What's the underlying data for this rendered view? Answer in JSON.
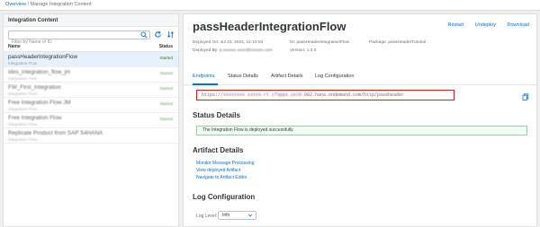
{
  "breadcrumb": {
    "link": "Overview",
    "separator": " / ",
    "current": "Manage Integration Content"
  },
  "left": {
    "title": "Integration Content",
    "search_placeholder": "Filter by Name or ID",
    "columns": {
      "name": "Name",
      "status": "Status"
    },
    "items": [
      {
        "name": "passHeaderIntegrationFlow",
        "sub": "Integration Flow",
        "status": "Started"
      },
      {
        "name": "ides_integration_flow_jm",
        "sub": "Integration Flow",
        "status": "Started"
      },
      {
        "name": "FW_First_Integration",
        "sub": "Integration Flow",
        "status": "Started"
      },
      {
        "name": "Free Integration Flow JM",
        "sub": "Integration Flow",
        "status": "Started"
      },
      {
        "name": "Free Integration Flow",
        "sub": "Integration Flow",
        "status": "Started"
      },
      {
        "name": "Replicate Product from SAP S4HANA",
        "sub": "Integration Flow",
        "status": ""
      }
    ]
  },
  "header": {
    "title": "passHeaderIntegrationFlow",
    "actions": {
      "restart": "Restart",
      "undeploy": "Undeploy",
      "download": "Download"
    },
    "deployed_on_label": "Deployed On:",
    "deployed_on_value": "Jul 23, 2024, 12:10:04",
    "deployed_by_label": "Deployed By:",
    "deployed_by_value": "p.xxxxxx.xxxx@xxxxxx.com",
    "id_label": "ID:",
    "id_value": "passHeaderIntegrationFlow",
    "version_label": "Version:",
    "version_value": "1.0.0",
    "package_label": "Package:",
    "package_value": "passHeaderTutorial"
  },
  "tabs": [
    "Endpoints",
    "Status Details",
    "Artifact Details",
    "Log Configuration"
  ],
  "endpoint": {
    "prefix": "https://",
    "masked": "xxxxxxxx.xxxxx-rt.cfapps.us10-",
    "suffix": "002.hana.ondemand.com/http/passheader"
  },
  "status_details": {
    "title": "Status Details",
    "message": "The Integration Flow is deployed successfully."
  },
  "artifact_details": {
    "title": "Artifact Details",
    "links": [
      "Monitor Message Processing",
      "View deployed Artifact",
      "Navigate to Artifact Editor"
    ]
  },
  "log_config": {
    "title": "Log Configuration",
    "label": "Log Level:",
    "value": "Info"
  },
  "colors": {
    "accent": "#0a6ed1",
    "success": "#2b7d2b",
    "highlight_border": "#d32020"
  }
}
